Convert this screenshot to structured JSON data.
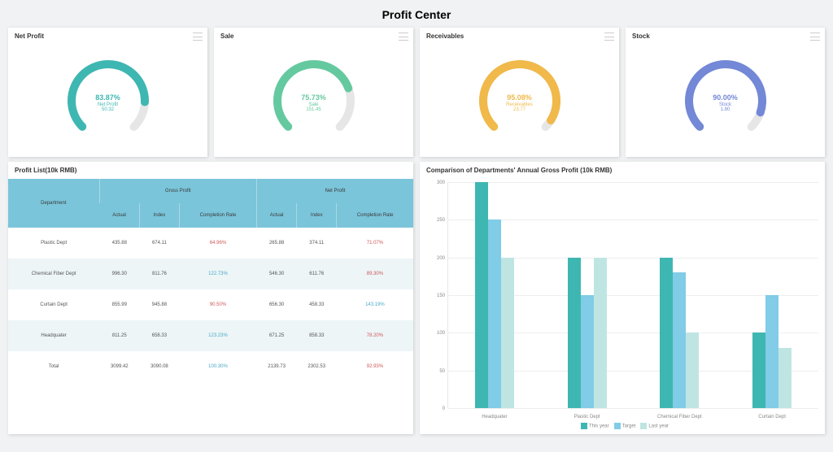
{
  "title": "Profit Center",
  "gauges": [
    {
      "title": "Net Profit",
      "percent": "83.87%",
      "label": "Net Profit",
      "value": "50.32",
      "color": "#3eb7b2",
      "frac": 0.8387
    },
    {
      "title": "Sale",
      "percent": "75.73%",
      "label": "Sale",
      "value": "151.45",
      "color": "#65c9a0",
      "frac": 0.7573
    },
    {
      "title": "Receivables",
      "percent": "95.08%",
      "label": "Receivables",
      "value": "23.77",
      "color": "#f0b94a",
      "frac": 0.9508
    },
    {
      "title": "Stock",
      "percent": "90.00%",
      "label": "Stock",
      "value": "1.80",
      "color": "#7388d6",
      "frac": 0.9
    }
  ],
  "profitList": {
    "title": "Profit List(10k RMB)",
    "headers": {
      "dept": "Department",
      "gross": "Gross Profit",
      "net": "Net Profit",
      "actual": "Actual",
      "index": "Index",
      "rate": "Completion Rate"
    },
    "rows": [
      {
        "dept": "Plastic Dept",
        "ga": "435.88",
        "gi": "674.11",
        "gr": "64.96%",
        "grc": "red",
        "na": "265.88",
        "ni": "374.11",
        "nr": "71.07%",
        "nrc": "red"
      },
      {
        "dept": "Chemical Fiber Dept",
        "ga": "996.30",
        "gi": "811.76",
        "gr": "122.73%",
        "grc": "green",
        "na": "546.30",
        "ni": "611.76",
        "nr": "89.30%",
        "nrc": "red"
      },
      {
        "dept": "Curtain Dept",
        "ga": "855.99",
        "gi": "945.88",
        "gr": "90.50%",
        "grc": "red",
        "na": "656.30",
        "ni": "458.33",
        "nr": "143.19%",
        "nrc": "green"
      },
      {
        "dept": "Headquater",
        "ga": "811.25",
        "gi": "658.33",
        "gr": "123.23%",
        "grc": "green",
        "na": "671.25",
        "ni": "858.33",
        "nr": "78.20%",
        "nrc": "red"
      },
      {
        "dept": "Total",
        "ga": "3099.42",
        "gi": "3090.08",
        "gr": "100.30%",
        "grc": "green",
        "na": "2139.73",
        "ni": "2302.53",
        "nr": "92.93%",
        "nrc": "red"
      }
    ]
  },
  "chart_data": {
    "title": "Comparison of Departments' Annual Gross Profit (10k RMB)",
    "type": "bar",
    "categories": [
      "Headquater",
      "Plastic Dept",
      "Chemical Fiber Dept",
      "Curtain Dept"
    ],
    "series": [
      {
        "name": "This year",
        "color": "#3eb7b2",
        "values": [
          300,
          200,
          200,
          100
        ]
      },
      {
        "name": "Target",
        "color": "#81cce7",
        "values": [
          250,
          150,
          180,
          150
        ]
      },
      {
        "name": "Last year",
        "color": "#bfe5e3",
        "values": [
          200,
          200,
          100,
          80
        ]
      }
    ],
    "ylim": [
      0,
      300
    ],
    "yticks": [
      0,
      50,
      100,
      150,
      200,
      250,
      300
    ]
  }
}
